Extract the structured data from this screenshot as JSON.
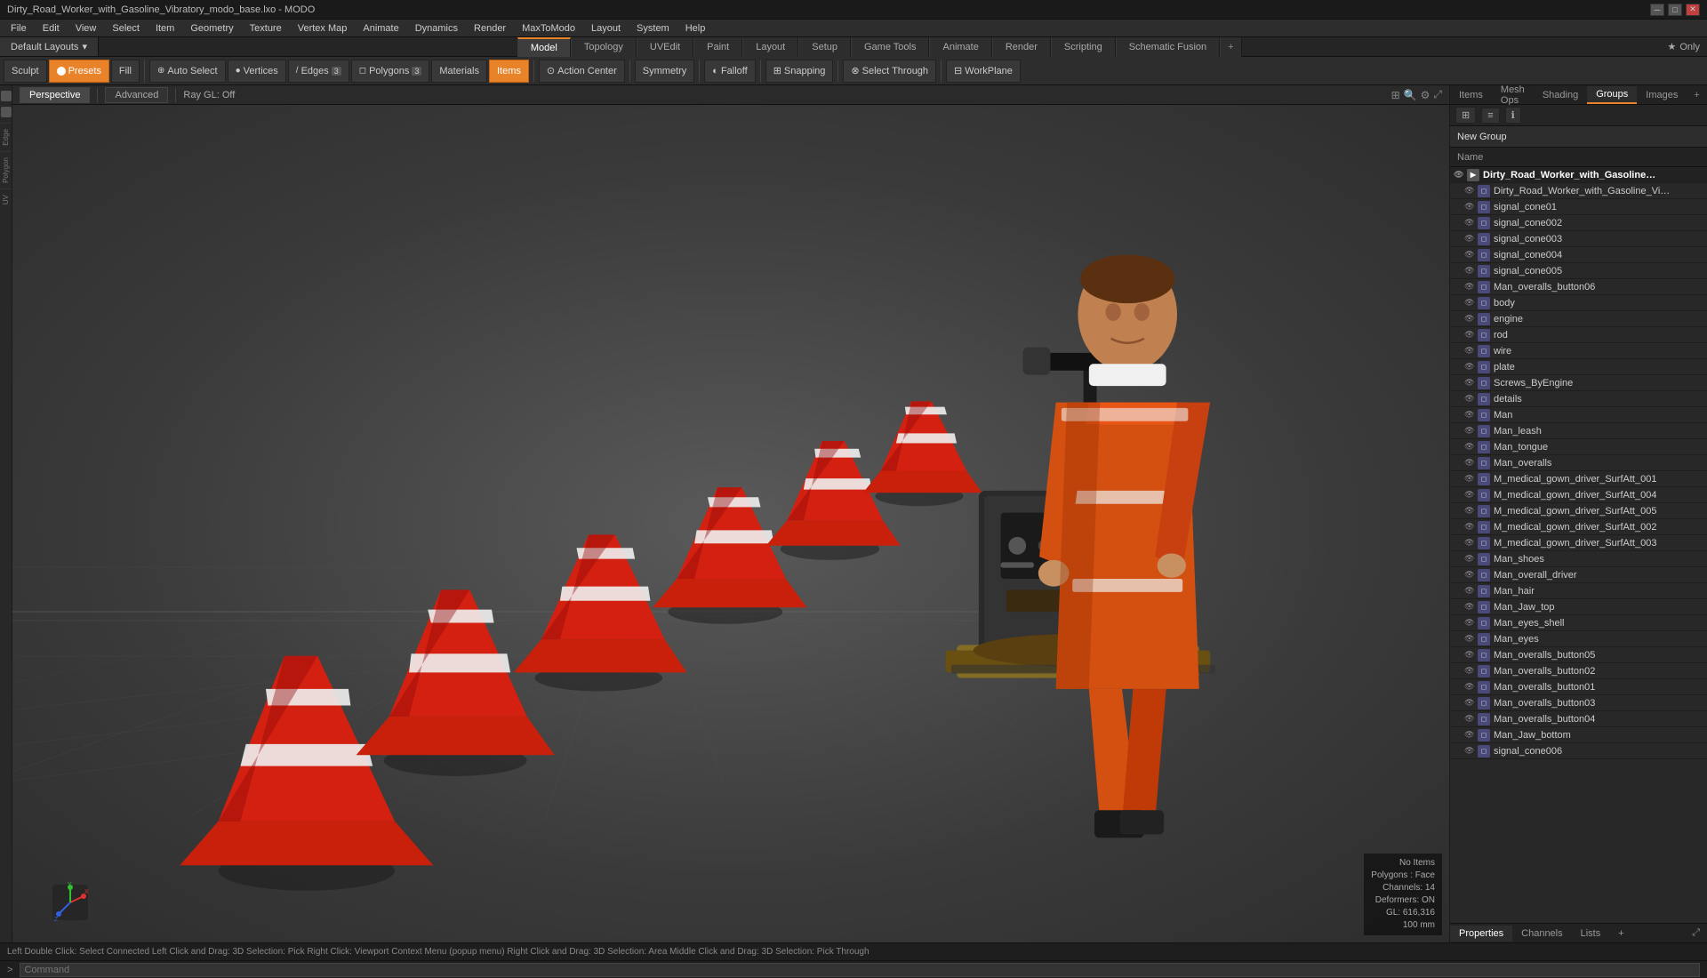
{
  "titlebar": {
    "title": "Dirty_Road_Worker_with_Gasoline_Vibratory_modo_base.lxo - MODO",
    "min": "─",
    "max": "□",
    "close": "✕"
  },
  "menubar": {
    "items": [
      "File",
      "Edit",
      "View",
      "Select",
      "Item",
      "Geometry",
      "Texture",
      "Vertex Map",
      "Animate",
      "Dynamics",
      "Render",
      "MaxToModo",
      "Layout",
      "System",
      "Help"
    ]
  },
  "layout": {
    "default_layouts": "Default Layouts",
    "dropdown_icon": "▾",
    "star": "★",
    "only_label": "Only",
    "plus_icon": "+",
    "add_icon": "+"
  },
  "mode_tabs": [
    {
      "id": "model",
      "label": "Model",
      "active": true
    },
    {
      "id": "topology",
      "label": "Topology",
      "active": false
    },
    {
      "id": "uvedit",
      "label": "UVEdit",
      "active": false
    },
    {
      "id": "paint",
      "label": "Paint",
      "active": false
    },
    {
      "id": "layout",
      "label": "Layout",
      "active": false
    },
    {
      "id": "setup",
      "label": "Setup",
      "active": false
    },
    {
      "id": "game_tools",
      "label": "Game Tools",
      "active": false
    },
    {
      "id": "animate",
      "label": "Animate",
      "active": false
    },
    {
      "id": "render",
      "label": "Render",
      "active": false
    },
    {
      "id": "scripting",
      "label": "Scripting",
      "active": false
    },
    {
      "id": "schematic_fusion",
      "label": "Schematic Fusion",
      "active": false
    }
  ],
  "toolbar": {
    "sculpt_label": "Sculpt",
    "presets_label": "Presets",
    "fill_label": "Fill",
    "auto_select_label": "Auto Select",
    "vertices_label": "Vertices",
    "edges_label": "Edges",
    "polygons_label": "Polygons",
    "materials_label": "Materials",
    "items_label": "Items",
    "action_center_label": "Action Center",
    "symmetry_label": "Symmetry",
    "falloff_label": "Falloff",
    "snapping_label": "Snapping",
    "select_through_label": "Select Through",
    "workplane_label": "WorkPlane",
    "edges_count": "3",
    "polygons_count": "3"
  },
  "viewport": {
    "tab_perspective": "Perspective",
    "tab_advanced": "Advanced",
    "ray_gl": "Ray GL: Off"
  },
  "viewport_info": {
    "no_items": "No Items",
    "polygons": "Polygons : Face",
    "channels": "Channels: 14",
    "deformers": "Deformers: ON",
    "gl": "GL: 616,316",
    "scale": "100 mm"
  },
  "right_panel": {
    "tabs": [
      "Items",
      "Mesh Ops",
      "Shading",
      "Groups",
      "Images"
    ],
    "active_tab": "Groups",
    "new_group_label": "New Group",
    "name_col": "Name",
    "add_icon": "+",
    "bottom_tabs": [
      "Properties",
      "Channels",
      "Lists"
    ],
    "active_bottom_tab": "Properties",
    "expand_icon": "⤢"
  },
  "scene_items": [
    {
      "id": "root",
      "label": "Dirty_Road_Worker_with_Gasoline_Vibratory_...",
      "indent": 0,
      "group": true,
      "eye": true
    },
    {
      "id": "item1",
      "label": "Dirty_Road_Worker_with_Gasoline_Vibratory",
      "indent": 1,
      "eye": true
    },
    {
      "id": "item2",
      "label": "signal_cone01",
      "indent": 1,
      "eye": true
    },
    {
      "id": "item3",
      "label": "signal_cone002",
      "indent": 1,
      "eye": true
    },
    {
      "id": "item4",
      "label": "signal_cone003",
      "indent": 1,
      "eye": true
    },
    {
      "id": "item5",
      "label": "signal_cone004",
      "indent": 1,
      "eye": true
    },
    {
      "id": "item6",
      "label": "signal_cone005",
      "indent": 1,
      "eye": true
    },
    {
      "id": "item7",
      "label": "Man_overalls_button06",
      "indent": 1,
      "eye": true
    },
    {
      "id": "item8",
      "label": "body",
      "indent": 1,
      "eye": true
    },
    {
      "id": "item9",
      "label": "engine",
      "indent": 1,
      "eye": true
    },
    {
      "id": "item10",
      "label": "rod",
      "indent": 1,
      "eye": true
    },
    {
      "id": "item11",
      "label": "wire",
      "indent": 1,
      "eye": true
    },
    {
      "id": "item12",
      "label": "plate",
      "indent": 1,
      "eye": true
    },
    {
      "id": "item13",
      "label": "Screws_ByEngine",
      "indent": 1,
      "eye": true
    },
    {
      "id": "item14",
      "label": "details",
      "indent": 1,
      "eye": true
    },
    {
      "id": "item15",
      "label": "Man",
      "indent": 1,
      "eye": true
    },
    {
      "id": "item16",
      "label": "Man_leash",
      "indent": 1,
      "eye": true
    },
    {
      "id": "item17",
      "label": "Man_tongue",
      "indent": 1,
      "eye": true
    },
    {
      "id": "item18",
      "label": "Man_overalls",
      "indent": 1,
      "eye": true
    },
    {
      "id": "item19",
      "label": "M_medical_gown_driver_SurfAtt_001",
      "indent": 1,
      "eye": true
    },
    {
      "id": "item20",
      "label": "M_medical_gown_driver_SurfAtt_004",
      "indent": 1,
      "eye": true
    },
    {
      "id": "item21",
      "label": "M_medical_gown_driver_SurfAtt_005",
      "indent": 1,
      "eye": true
    },
    {
      "id": "item22",
      "label": "M_medical_gown_driver_SurfAtt_002",
      "indent": 1,
      "eye": true
    },
    {
      "id": "item23",
      "label": "M_medical_gown_driver_SurfAtt_003",
      "indent": 1,
      "eye": true
    },
    {
      "id": "item24",
      "label": "Man_shoes",
      "indent": 1,
      "eye": true
    },
    {
      "id": "item25",
      "label": "Man_overall_driver",
      "indent": 1,
      "eye": true
    },
    {
      "id": "item26",
      "label": "Man_hair",
      "indent": 1,
      "eye": true
    },
    {
      "id": "item27",
      "label": "Man_Jaw_top",
      "indent": 1,
      "eye": true
    },
    {
      "id": "item28",
      "label": "Man_eyes_shell",
      "indent": 1,
      "eye": true
    },
    {
      "id": "item29",
      "label": "Man_eyes",
      "indent": 1,
      "eye": true
    },
    {
      "id": "item30",
      "label": "Man_overalls_button05",
      "indent": 1,
      "eye": true
    },
    {
      "id": "item31",
      "label": "Man_overalls_button02",
      "indent": 1,
      "eye": true
    },
    {
      "id": "item32",
      "label": "Man_overalls_button01",
      "indent": 1,
      "eye": true
    },
    {
      "id": "item33",
      "label": "Man_overalls_button03",
      "indent": 1,
      "eye": true
    },
    {
      "id": "item34",
      "label": "Man_overalls_button04",
      "indent": 1,
      "eye": true
    },
    {
      "id": "item35",
      "label": "Man_Jaw_bottom",
      "indent": 1,
      "eye": true
    },
    {
      "id": "item36",
      "label": "signal_cone006",
      "indent": 1,
      "eye": true
    }
  ],
  "statusbar": {
    "text": "Left Double Click: Select Connected  Left Click and Drag: 3D Selection: Pick  Right Click: Viewport Context Menu (popup menu)  Right Click and Drag: 3D Selection: Area  Middle Click and Drag: 3D Selection: Pick Through",
    "command_label": "Command",
    "cmd_arrow": ">"
  }
}
